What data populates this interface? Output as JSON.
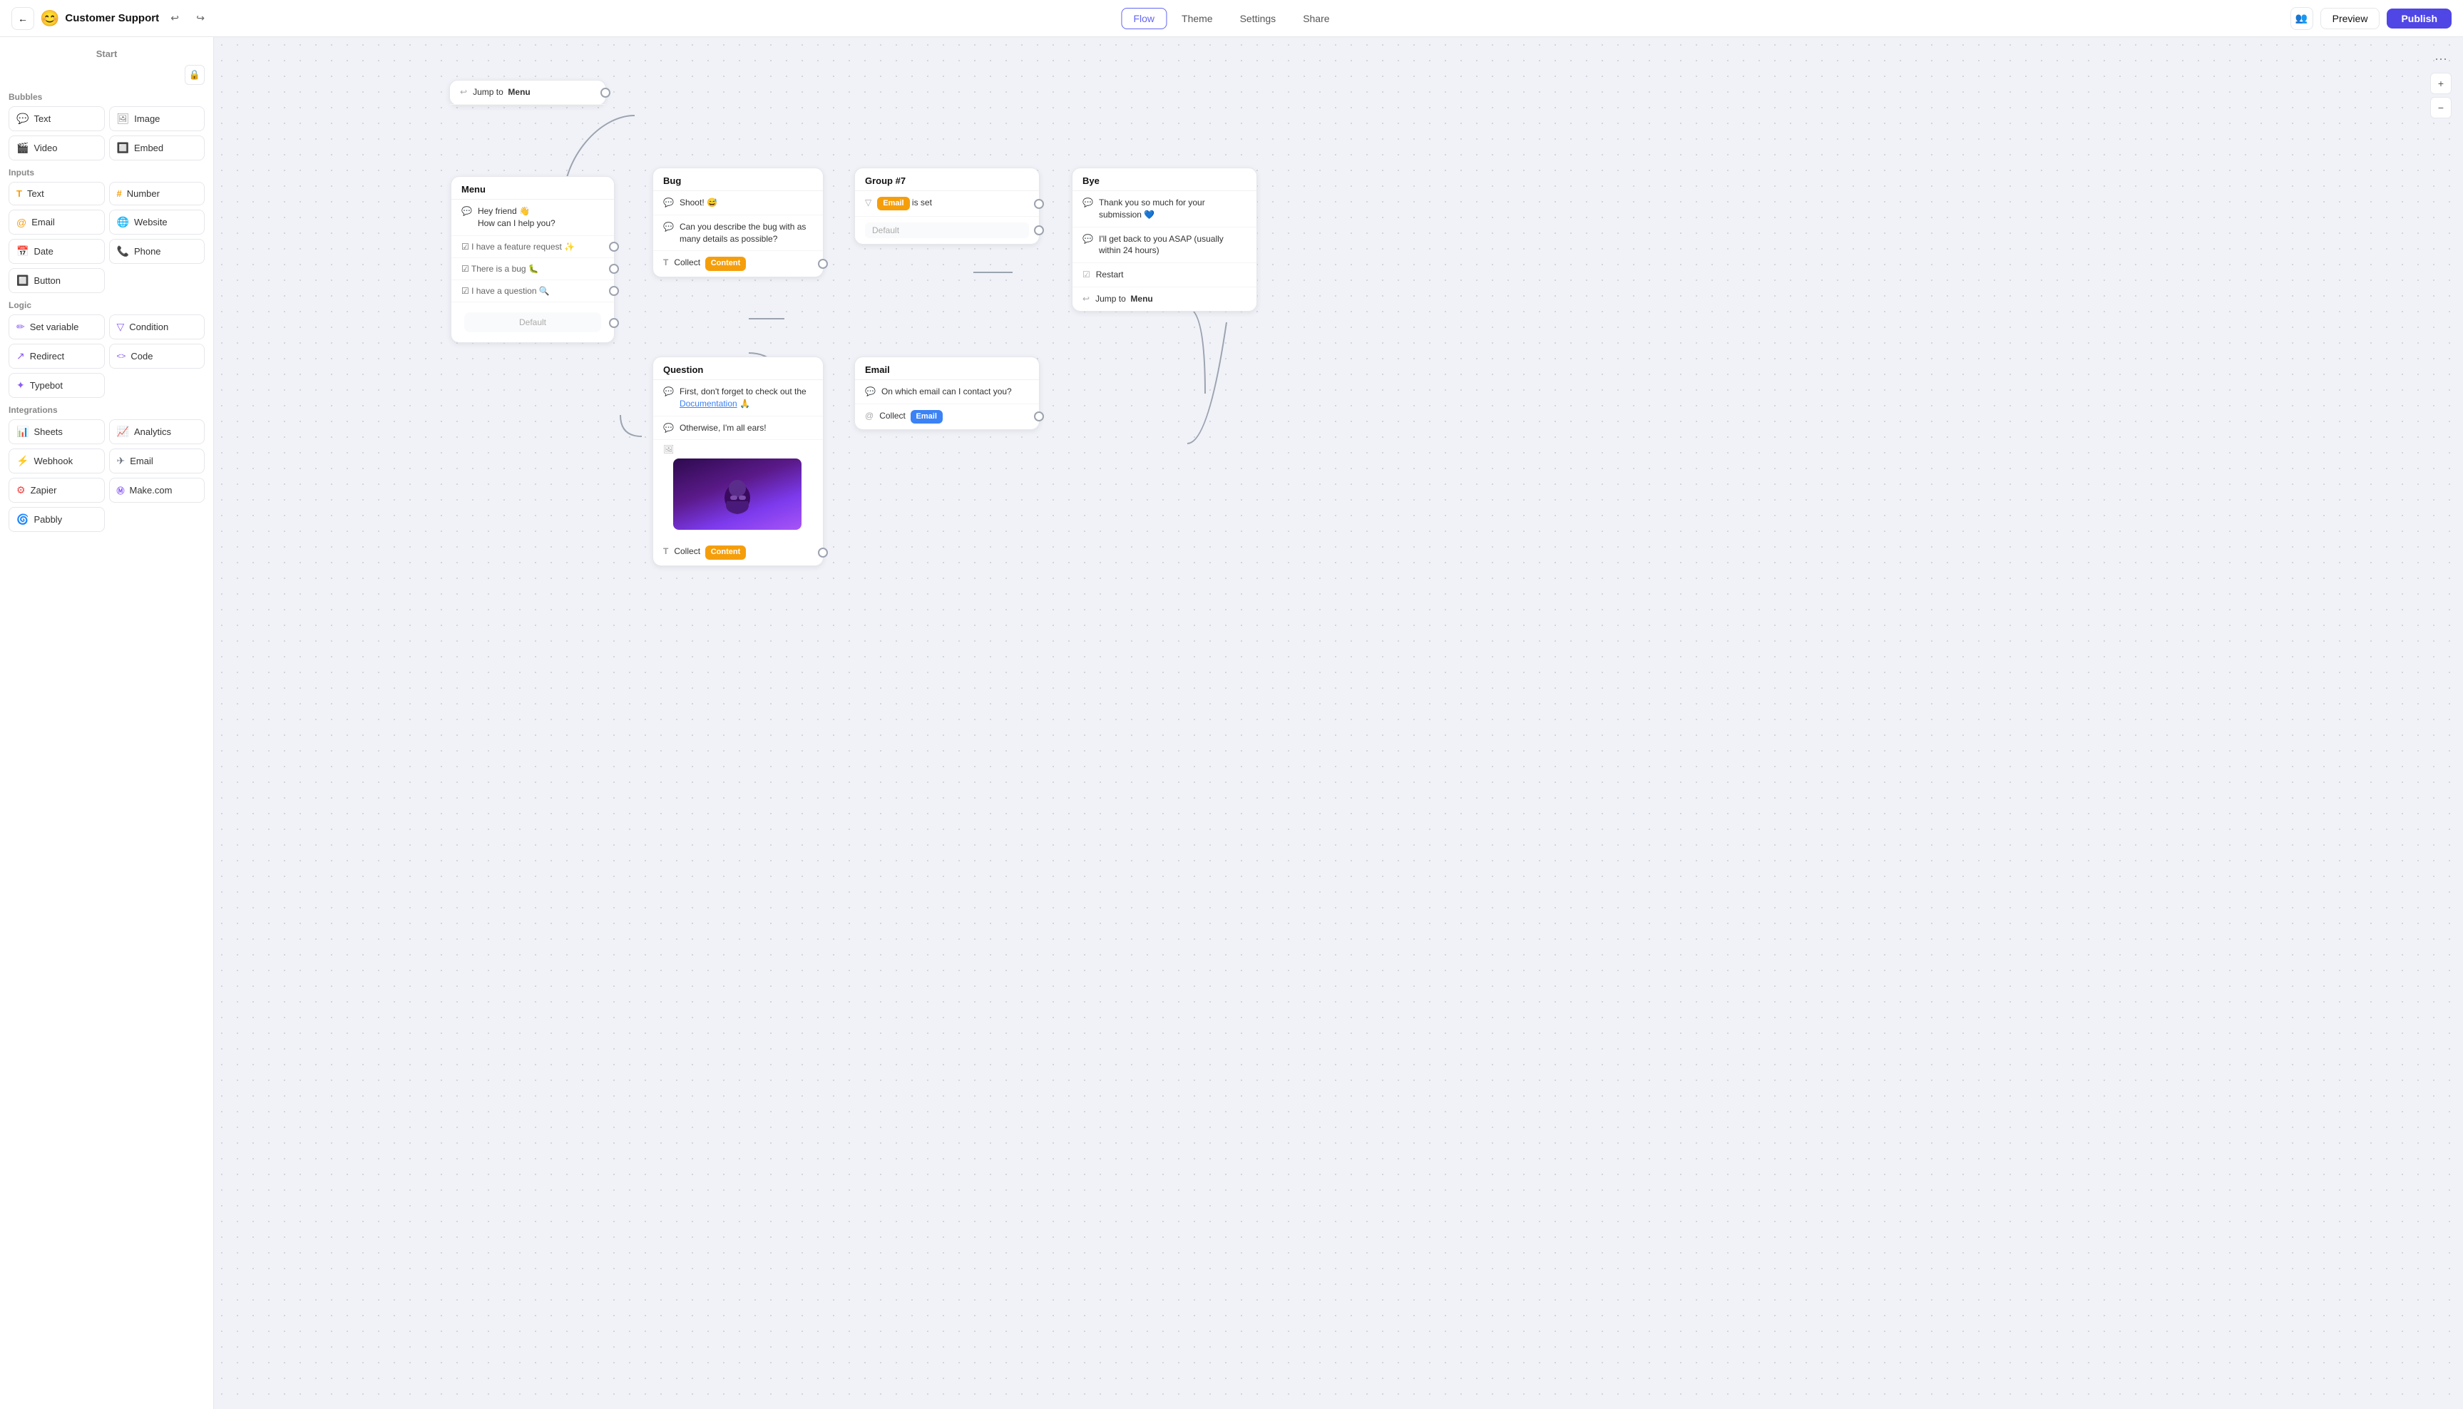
{
  "app": {
    "bot_icon": "😊",
    "bot_name": "Customer Support",
    "undo_icon": "↩",
    "redo_icon": "↪",
    "back_icon": "←",
    "lock_icon": "🔒"
  },
  "topnav": {
    "tabs": [
      {
        "id": "flow",
        "label": "Flow",
        "active": true
      },
      {
        "id": "theme",
        "label": "Theme",
        "active": false
      },
      {
        "id": "settings",
        "label": "Settings",
        "active": false
      },
      {
        "id": "share",
        "label": "Share",
        "active": false
      }
    ],
    "preview_label": "Preview",
    "publish_label": "Publish",
    "guests_icon": "👥"
  },
  "sidebar": {
    "start_label": "Start",
    "sections": [
      {
        "label": "Bubbles",
        "items": [
          {
            "id": "text-bubble",
            "icon": "💬",
            "label": "Text"
          },
          {
            "id": "image-bubble",
            "icon": "🖼",
            "label": "Image"
          },
          {
            "id": "video-bubble",
            "icon": "🎬",
            "label": "Video"
          },
          {
            "id": "embed-bubble",
            "icon": "🔲",
            "label": "Embed"
          }
        ]
      },
      {
        "label": "Inputs",
        "items": [
          {
            "id": "text-input",
            "icon": "T",
            "label": "Text"
          },
          {
            "id": "number-input",
            "icon": "#",
            "label": "Number"
          },
          {
            "id": "email-input",
            "icon": "✉",
            "label": "Email"
          },
          {
            "id": "website-input",
            "icon": "🌐",
            "label": "Website"
          },
          {
            "id": "date-input",
            "icon": "📅",
            "label": "Date"
          },
          {
            "id": "phone-input",
            "icon": "📞",
            "label": "Phone"
          },
          {
            "id": "button-input",
            "icon": "🔲",
            "label": "Button"
          }
        ]
      },
      {
        "label": "Logic",
        "items": [
          {
            "id": "set-variable",
            "icon": "✏",
            "label": "Set variable"
          },
          {
            "id": "condition",
            "icon": "▽",
            "label": "Condition"
          },
          {
            "id": "redirect",
            "icon": "↗",
            "label": "Redirect"
          },
          {
            "id": "code",
            "icon": "<>",
            "label": "Code"
          },
          {
            "id": "typebot",
            "icon": "✦",
            "label": "Typebot"
          }
        ]
      },
      {
        "label": "Integrations",
        "items": [
          {
            "id": "sheets",
            "icon": "📊",
            "label": "Sheets"
          },
          {
            "id": "analytics",
            "icon": "📈",
            "label": "Analytics"
          },
          {
            "id": "webhook",
            "icon": "⚡",
            "label": "Webhook"
          },
          {
            "id": "email-int",
            "icon": "✈",
            "label": "Email"
          },
          {
            "id": "zapier",
            "icon": "⚙",
            "label": "Zapier"
          },
          {
            "id": "makecom",
            "icon": "Ⓜ",
            "label": "Make.com"
          },
          {
            "id": "pabbly",
            "icon": "🌀",
            "label": "Pabbly"
          }
        ]
      }
    ]
  },
  "canvas": {
    "more_icon": "⋯",
    "plus_icon": "+",
    "minus_icon": "−"
  },
  "nodes": {
    "jump_menu": {
      "label": "Jump to",
      "target": "Menu",
      "icon": "↩"
    },
    "menu_node": {
      "title": "Menu",
      "rows": [
        {
          "icon": "💬",
          "text": "Hey friend 👋\nHow can I help you?",
          "type": "bubble"
        },
        {
          "icon": "☑",
          "text": "I have a feature request ✨",
          "type": "choice"
        },
        {
          "icon": "☑",
          "text": "There is a bug 🐛",
          "type": "choice"
        },
        {
          "icon": "☑",
          "text": "I have a question 🔍",
          "type": "choice"
        },
        {
          "type": "default",
          "text": "Default"
        }
      ]
    },
    "bug_node": {
      "title": "Bug",
      "rows": [
        {
          "icon": "💬",
          "text": "Shoot! 😅",
          "type": "bubble"
        },
        {
          "icon": "💬",
          "text": "Can you describe the bug with as many details as possible?",
          "type": "bubble"
        },
        {
          "icon": "T",
          "text": "Collect",
          "tag": "Content",
          "tag_color": "orange",
          "type": "collect"
        }
      ]
    },
    "group7_node": {
      "title": "Group #7",
      "rows": [
        {
          "icon": "▽",
          "tag": "Email",
          "tag_color": "orange",
          "text": " is set",
          "type": "condition"
        },
        {
          "text": "Default",
          "type": "default"
        }
      ]
    },
    "bye_node": {
      "title": "Bye",
      "rows": [
        {
          "icon": "💬",
          "text": "Thank you so much for your submission 💙",
          "type": "bubble"
        },
        {
          "icon": "💬",
          "text": "I'll get back to you ASAP (usually within 24 hours)",
          "type": "bubble"
        },
        {
          "icon": "☑",
          "text": "Restart",
          "type": "choice"
        },
        {
          "icon": "↩",
          "text": "Jump to  Menu",
          "type": "jump"
        }
      ]
    },
    "question_node": {
      "title": "Question",
      "rows": [
        {
          "icon": "💬",
          "text": "First, don't forget to check out the Documentation 🙏",
          "type": "bubble",
          "has_link": true
        },
        {
          "icon": "💬",
          "text": "Otherwise, I'm all ears!",
          "type": "bubble"
        },
        {
          "type": "gif"
        },
        {
          "icon": "T",
          "text": "Collect",
          "tag": "Content",
          "tag_color": "orange",
          "type": "collect"
        }
      ]
    },
    "email_node": {
      "title": "Email",
      "rows": [
        {
          "icon": "💬",
          "text": "On which email can I contact you?",
          "type": "bubble"
        },
        {
          "icon": "✉",
          "text": "Collect",
          "tag": "Email",
          "tag_color": "blue",
          "type": "collect"
        }
      ]
    }
  }
}
